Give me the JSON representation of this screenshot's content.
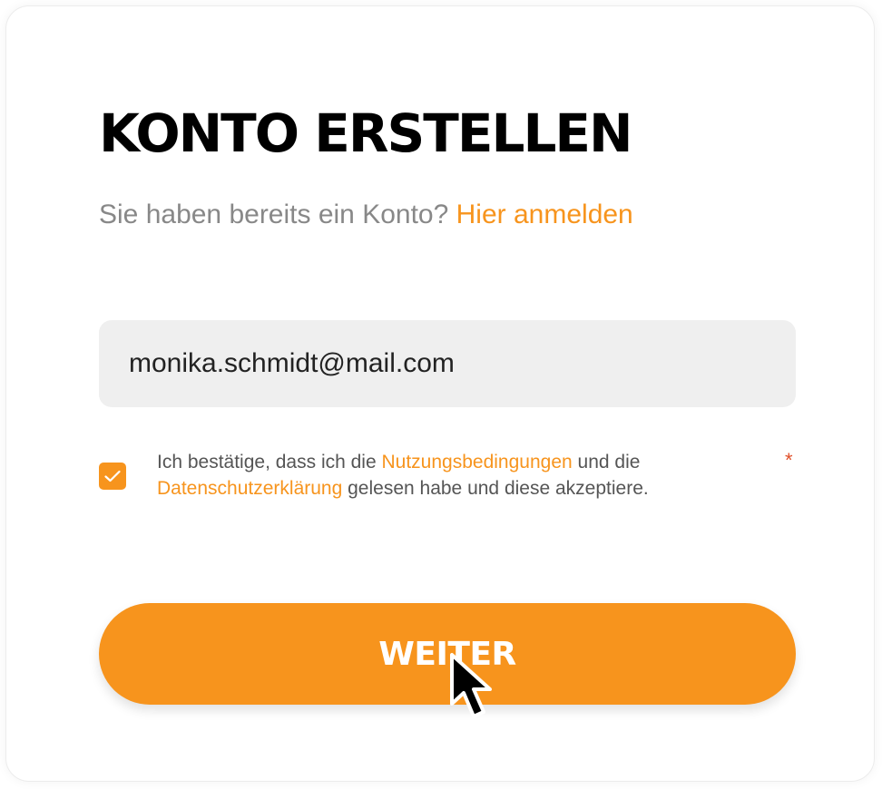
{
  "title": "KONTO ERSTELLEN",
  "subtitle": {
    "text": "Sie haben bereits ein Konto?",
    "login_link": "Hier anmelden"
  },
  "email": {
    "value": "monika.schmidt@mail.com",
    "placeholder": ""
  },
  "consent": {
    "checked": true,
    "text_1": "Ich bestätige, dass ich die",
    "terms_link": "Nutzungsbedingungen",
    "text_2": "und die",
    "privacy_link": "Datenschutzerklärung",
    "text_3": "gelesen habe und diese akzeptiere.",
    "required_mark": "*"
  },
  "submit_label": "WEITER",
  "colors": {
    "accent": "#f7941d",
    "field_bg": "#efefef",
    "required": "#e0502a",
    "muted_text": "#888888"
  },
  "icons": {
    "checkbox": "checkmark-icon",
    "pointer": "mouse-cursor-icon"
  }
}
